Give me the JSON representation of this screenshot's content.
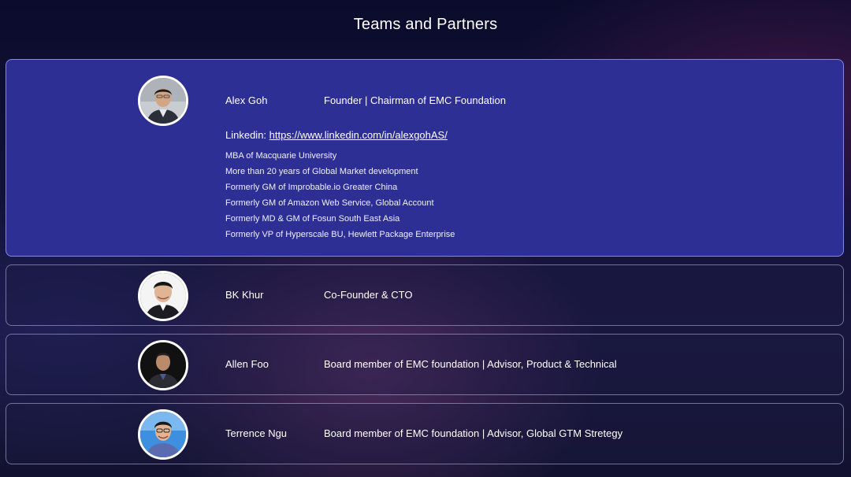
{
  "page": {
    "title": "Teams and Partners"
  },
  "members": [
    {
      "name": "Alex Goh",
      "role": "Founder | Chairman of EMC Foundation",
      "linkedin_label": "Linkedin:",
      "linkedin_url": "https://www.linkedin.com/in/alexgohAS/",
      "bio": [
        "MBA of Macquarie University",
        "More than 20 years of Global Market development",
        "Formerly GM of Improbable.io Greater China",
        "Formerly GM of Amazon Web Service, Global Account",
        "Formerly MD & GM of Fosun South East Asia",
        "Formerly VP of Hyperscale BU, Hewlett Package Enterprise"
      ]
    },
    {
      "name": "BK Khur",
      "role": "Co-Founder & CTO"
    },
    {
      "name": "Allen Foo",
      "role": "Board member of EMC foundation | Advisor, Product & Technical"
    },
    {
      "name": "Terrence Ngu",
      "role": "Board member of EMC foundation | Advisor, Global GTM Stretegy"
    }
  ],
  "colors": {
    "expanded_card": "#2e2f94",
    "background": "#13123a"
  }
}
